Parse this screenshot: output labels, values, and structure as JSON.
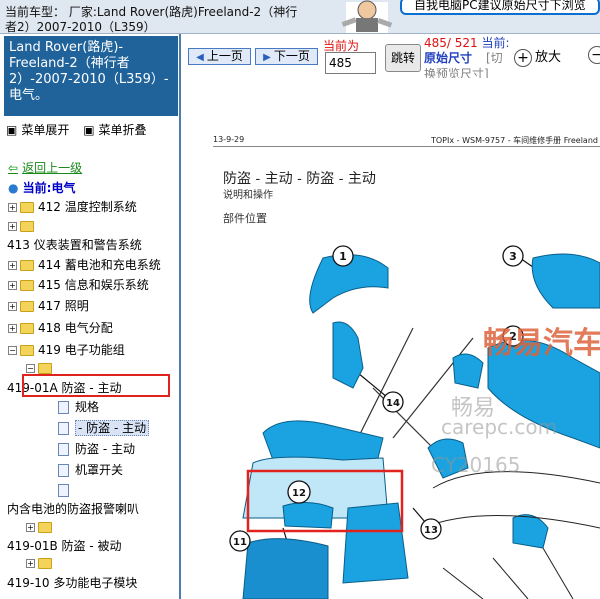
{
  "topbar": {
    "model_line": "当前车型： 厂家:Land Rover(路虎)Freeland-2（神行者2）2007-2010（L359）",
    "tip": "自我电脑PC建议原始尺寸下浏览"
  },
  "sidebar": {
    "title": "Land Rover(路虎)-Freeland-2（神行者2）-2007-2010（L359）- 电气。",
    "expand_label": "菜单展开",
    "collapse_label": "菜单折叠",
    "back_label": "返回上一级",
    "current_label": "当前:电气",
    "tree": {
      "r412": "412 温度控制系统",
      "r413": "413 仪表装置和警告系统",
      "r414": "414 蓄电池和充电系统",
      "r415": "415 信息和娱乐系统",
      "r417": "417 照明",
      "r418": "418 电气分配",
      "r419": "419 电子功能组",
      "r41901a": "419-01A 防盗 - 主动",
      "spec": "规格",
      "antitheft_sel": "- 防盗 - 主动",
      "antitheft2": "防盗 - 主动",
      "hood_switch": "机罩开关",
      "horn": "内含电池的防盗报警喇叭",
      "r41901b": "419-01B 防盗 - 被动",
      "r41910": "419-10 多功能电子模块"
    }
  },
  "toolbar": {
    "prev_label": "上一页",
    "next_label": "下一页",
    "page_label": "当前为",
    "page_value": "485",
    "go_label": "跳转",
    "page_count": "485/ 521",
    "current_suffix": "当前:",
    "size_label": "原始尺寸",
    "switch_label": "[切",
    "switch_label2": "换预览尺寸]",
    "zoom_in_label": "放大"
  },
  "document": {
    "page_date": "13-9-29",
    "header_right": "TOPIx - WSM-9757 - 车间维修手册 Freeland",
    "title": "防盗 - 主动 - 防盗 - 主动",
    "subtitle": "说明和操作",
    "section": "部件位置",
    "callouts": [
      "1",
      "2",
      "3",
      "11",
      "12",
      "13",
      "14"
    ],
    "watermark_cn": "畅易汽车",
    "watermark_cn2": "畅易",
    "watermark_url": "carepc.com",
    "watermark_id": "CY20165"
  },
  "colors": {
    "sidebar_title_bg": "#20639b",
    "highlight_red": "#e0231e",
    "part_blue": "#1aa3e0"
  }
}
